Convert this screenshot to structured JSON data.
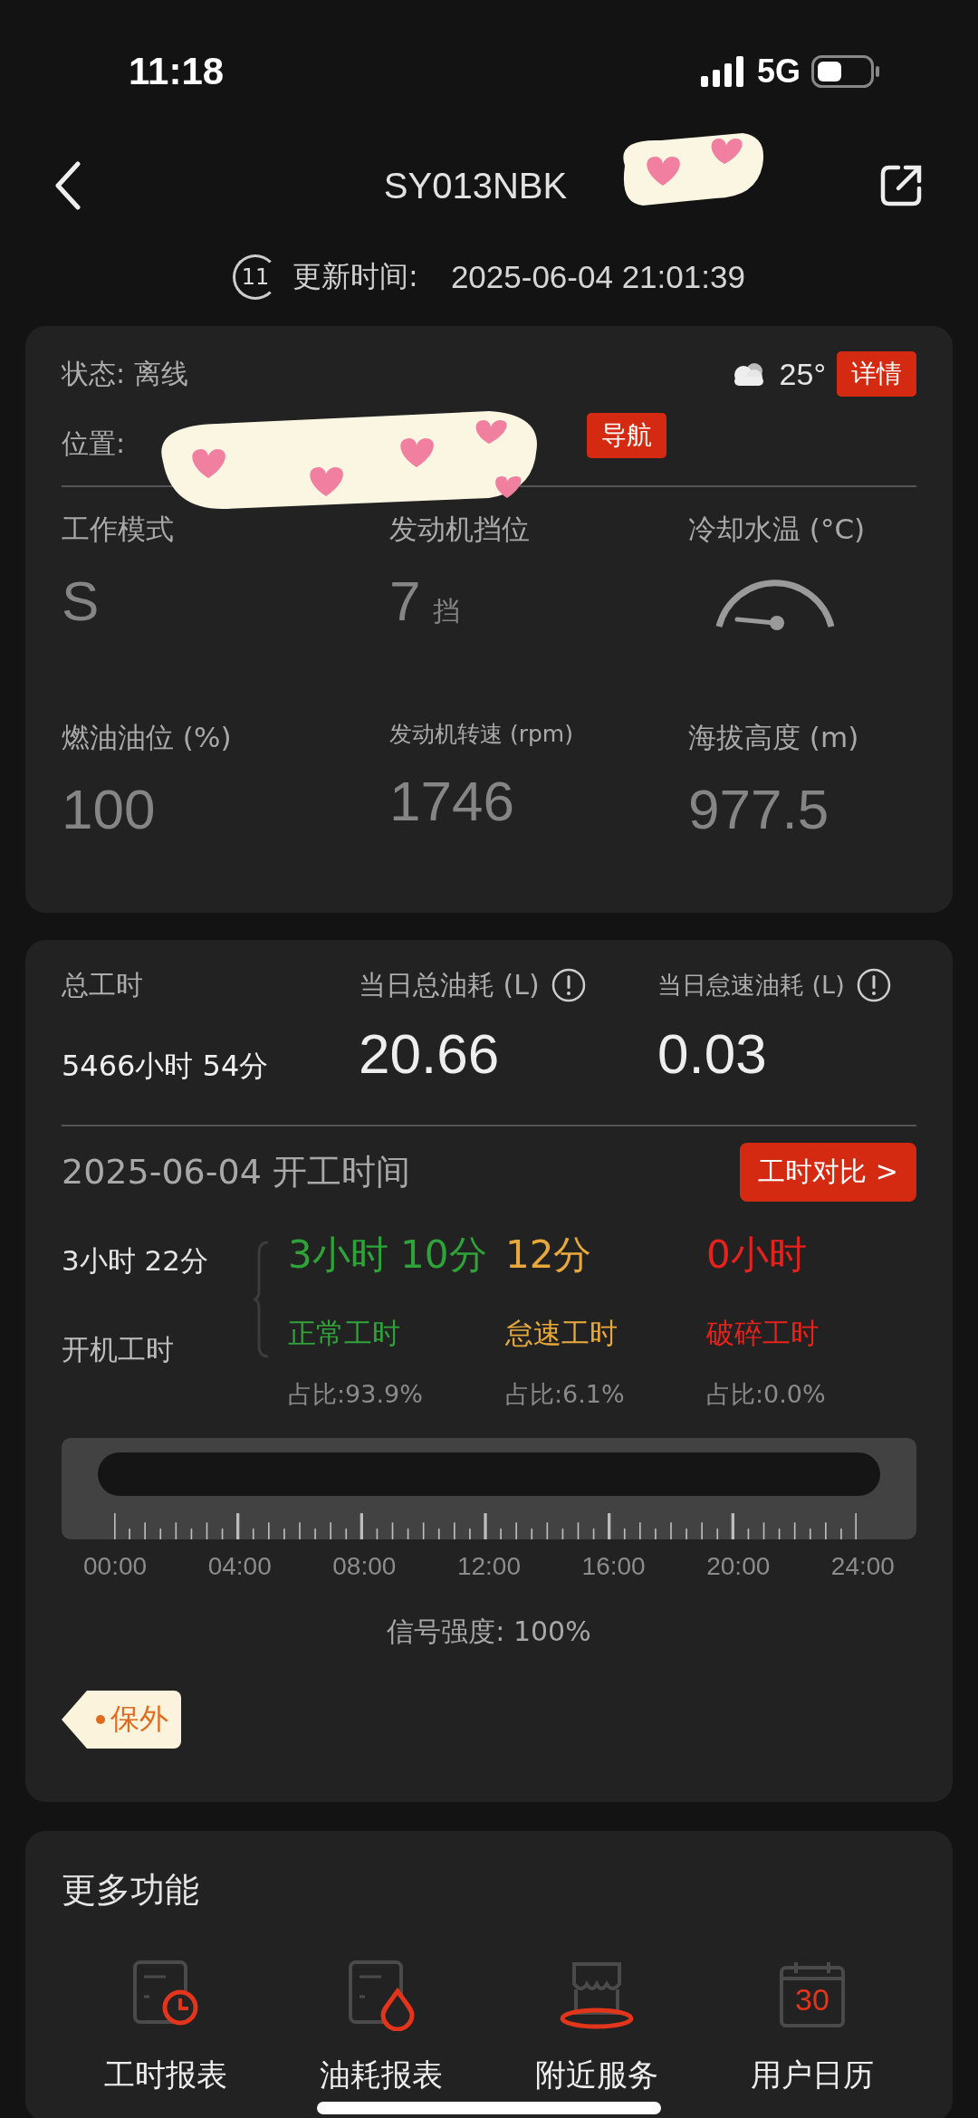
{
  "status_bar": {
    "time": "11:18",
    "network": "5G"
  },
  "header": {
    "title": "SY013NBK"
  },
  "update": {
    "badge": "11",
    "label": "更新时间:",
    "value": "2025-06-04 21:01:39"
  },
  "status_card": {
    "status": "状态: 离线",
    "temperature": "25°",
    "details_button": "详情",
    "location_label": "位置:",
    "navigate_button": "导航",
    "metrics": [
      {
        "kind": "text",
        "label": "工作模式",
        "value": "S"
      },
      {
        "kind": "text",
        "label": "发动机挡位",
        "value": "7",
        "unit": "挡"
      },
      {
        "kind": "gauge",
        "label": "冷却水温 (°C)"
      },
      {
        "kind": "text",
        "label": "燃油油位 (%)",
        "value": "100"
      },
      {
        "kind": "text",
        "label": "发动机转速 (rpm)",
        "value": "1746"
      },
      {
        "kind": "text",
        "label": "海拔高度 (m)",
        "value": "977.5"
      }
    ]
  },
  "hours_card": {
    "total_label": "总工时",
    "total_value": "5466小时 54分",
    "fuel": [
      {
        "label": "当日总油耗 (L)",
        "value": "20.66"
      },
      {
        "label": "当日怠速油耗 (L)",
        "value": "0.03"
      }
    ],
    "date_title": "2025-06-04 开工时间",
    "compare_button": "工时对比 >",
    "run_value": "3小时 22分",
    "run_label": "开机工时",
    "breakdown": [
      {
        "value": "3小时 10分",
        "label": "正常工时",
        "share": "占比:93.9%",
        "color": "#2fa33a"
      },
      {
        "value": "12分",
        "label": "怠速工时",
        "share": "占比:6.1%",
        "color": "#e8a93a"
      },
      {
        "value": "0小时",
        "label": "破碎工时",
        "share": "占比:0.0%",
        "color": "#e5231c"
      }
    ],
    "axis_labels": [
      "00:00",
      "04:00",
      "08:00",
      "12:00",
      "16:00",
      "20:00",
      "24:00"
    ],
    "signal": "信号强度: 100%",
    "tag": "保外"
  },
  "more": {
    "title": "更多功能",
    "items": [
      {
        "kind": "clock-report",
        "label": "工时报表"
      },
      {
        "kind": "fuel-report",
        "label": "油耗报表"
      },
      {
        "kind": "shop",
        "label": "附近服务"
      },
      {
        "kind": "calendar",
        "label": "用户日历",
        "icon_text": "30"
      }
    ]
  }
}
